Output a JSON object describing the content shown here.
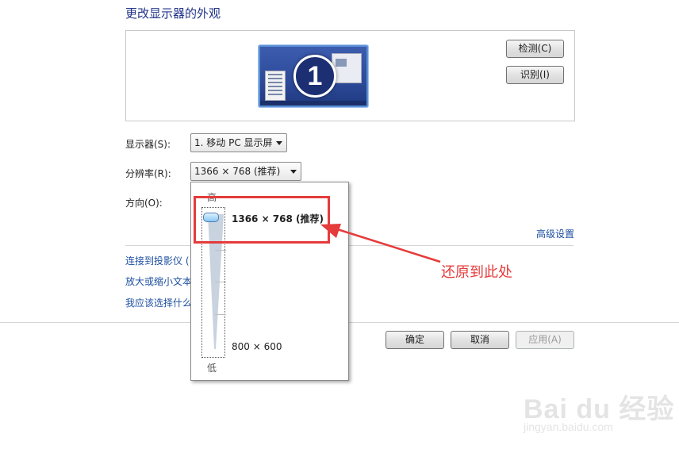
{
  "page": {
    "title": "更改显示器的外观"
  },
  "preview": {
    "monitor_number": "1",
    "detect_label": "检测(C)",
    "identify_label": "识别(I)"
  },
  "display": {
    "label": "显示器(S):",
    "value": "1. 移动 PC 显示屏"
  },
  "resolution": {
    "label": "分辨率(R):",
    "value": "1366 × 768 (推荐)"
  },
  "orientation": {
    "label": "方向(O):"
  },
  "advanced_link": "高级设置",
  "links": [
    "连接到投影仪 (",
    "放大或缩小文本",
    "我应该选择什么"
  ],
  "slider": {
    "high_label": "高",
    "low_label": "低",
    "current": "1366 × 768 (推荐)",
    "min": "800 × 600",
    "level": 1.0
  },
  "buttons": {
    "ok": "确定",
    "cancel": "取消",
    "apply": "应用(A)"
  },
  "annotation": {
    "note": "还原到此处",
    "color": "#e53b3b"
  },
  "watermark": {
    "logo": "Bai du 经验",
    "url": "jingyan.baidu.com"
  },
  "icons": [
    "dropdown-arrow-icon",
    "slider-thumb-icon",
    "red-arrow-icon"
  ]
}
